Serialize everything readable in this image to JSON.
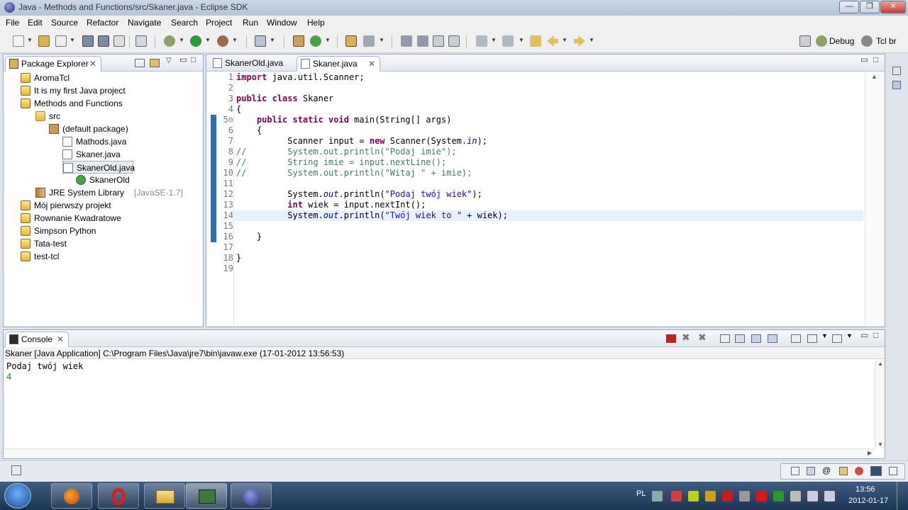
{
  "window": {
    "title": "Java - Methods and Functions/src/Skaner.java - Eclipse SDK",
    "minimize_label": "—",
    "restore_label": "❐",
    "close_label": "✕"
  },
  "menu": [
    "File",
    "Edit",
    "Source",
    "Refactor",
    "Navigate",
    "Search",
    "Project",
    "Run",
    "Window",
    "Help"
  ],
  "perspectives": {
    "debug_label": "Debug",
    "tcl_label": "Tcl br"
  },
  "package_explorer": {
    "title": "Package Explorer",
    "items": [
      {
        "label": "AromaTcl",
        "icon": "project-folder-icon",
        "extra": ""
      },
      {
        "label": "It is my first Java project",
        "icon": "project-folder-icon",
        "extra": ""
      },
      {
        "label": "Methods and Functions",
        "icon": "project-folder-icon",
        "extra": ""
      },
      {
        "label": "src",
        "icon": "source-folder-icon",
        "extra": ""
      },
      {
        "label": "(default package)",
        "icon": "package-icon",
        "extra": ""
      },
      {
        "label": "Mathods.java",
        "icon": "java-file-icon",
        "extra": ""
      },
      {
        "label": "Skaner.java",
        "icon": "java-file-icon",
        "extra": ""
      },
      {
        "label": "SkanerOld.java",
        "icon": "java-file-icon",
        "extra": ""
      },
      {
        "label": "SkanerOld",
        "icon": "class-icon",
        "extra": ""
      },
      {
        "label": "JRE System Library",
        "icon": "library-icon",
        "extra": "[JavaSE-1.7]"
      },
      {
        "label": "Mój pierwszy projekt",
        "icon": "project-folder-icon",
        "extra": ""
      },
      {
        "label": "Rownanie Kwadratowe",
        "icon": "project-folder-icon",
        "extra": ""
      },
      {
        "label": "Simpson Python",
        "icon": "project-folder-icon",
        "extra": ""
      },
      {
        "label": "Tata-test",
        "icon": "project-folder-icon",
        "extra": ""
      },
      {
        "label": "test-tcl",
        "icon": "project-folder-icon",
        "extra": ""
      }
    ]
  },
  "editor": {
    "tabs": [
      {
        "label": "SkanerOld.java"
      },
      {
        "label": "Skaner.java"
      }
    ],
    "lines": [
      {
        "n": "1",
        "segments": [
          {
            "t": "kw",
            "v": "import"
          },
          {
            "t": "plain",
            "v": " java.util.Scanner;"
          }
        ]
      },
      {
        "n": "2",
        "segments": []
      },
      {
        "n": "3",
        "segments": [
          {
            "t": "kw",
            "v": "public class"
          },
          {
            "t": "plain",
            "v": " Skaner"
          }
        ]
      },
      {
        "n": "4",
        "segments": [
          {
            "t": "plain",
            "v": "{"
          }
        ]
      },
      {
        "n": "5⊖",
        "segments": [
          {
            "t": "plain",
            "v": "    "
          },
          {
            "t": "kw",
            "v": "public static void"
          },
          {
            "t": "plain",
            "v": " main(String[] args)"
          }
        ]
      },
      {
        "n": "6",
        "segments": [
          {
            "t": "plain",
            "v": "    {"
          }
        ]
      },
      {
        "n": "7",
        "segments": [
          {
            "t": "plain",
            "v": "          Scanner input = "
          },
          {
            "t": "kw",
            "v": "new"
          },
          {
            "t": "plain",
            "v": " Scanner(System."
          },
          {
            "t": "fld",
            "v": "in"
          },
          {
            "t": "plain",
            "v": ");"
          }
        ]
      },
      {
        "n": "8",
        "segments": [
          {
            "t": "cmt",
            "v": "//        System.out.println(\"Podaj imie\");"
          }
        ]
      },
      {
        "n": "9",
        "segments": [
          {
            "t": "cmt",
            "v": "//        String imie = input.nextLine();"
          }
        ]
      },
      {
        "n": "10",
        "segments": [
          {
            "t": "cmt",
            "v": "//        System.out.println(\"Witaj \" + imie);"
          }
        ]
      },
      {
        "n": "11",
        "segments": []
      },
      {
        "n": "12",
        "segments": [
          {
            "t": "plain",
            "v": "          System."
          },
          {
            "t": "fld",
            "v": "out"
          },
          {
            "t": "plain",
            "v": ".println("
          },
          {
            "t": "str",
            "v": "\"Podaj twój wiek\""
          },
          {
            "t": "plain",
            "v": ");"
          }
        ]
      },
      {
        "n": "13",
        "segments": [
          {
            "t": "plain",
            "v": "          "
          },
          {
            "t": "kw",
            "v": "int"
          },
          {
            "t": "plain",
            "v": " wiek = input.nextInt();"
          }
        ]
      },
      {
        "n": "14",
        "segments": [
          {
            "t": "plain",
            "v": "          System."
          },
          {
            "t": "fld",
            "v": "out"
          },
          {
            "t": "plain",
            "v": ".println("
          },
          {
            "t": "str",
            "v": "\"Twój wiek to \""
          },
          {
            "t": "plain",
            "v": " + wiek);"
          }
        ]
      },
      {
        "n": "15",
        "segments": []
      },
      {
        "n": "16",
        "segments": [
          {
            "t": "plain",
            "v": "    }"
          }
        ]
      },
      {
        "n": "17",
        "segments": []
      },
      {
        "n": "18",
        "segments": [
          {
            "t": "plain",
            "v": "}"
          }
        ]
      },
      {
        "n": "19",
        "segments": []
      }
    ]
  },
  "console": {
    "title": "Console",
    "process_line": "Skaner [Java Application] C:\\Program Files\\Java\\jre7\\bin\\javaw.exe (17-01-2012 13:56:53)",
    "output": [
      "Podaj twój wiek"
    ],
    "input": [
      "4"
    ]
  },
  "taskbar": {
    "language": "PL",
    "time": "13:56",
    "date": "2012-01-17"
  },
  "colors": {
    "keyword": "#7f0055",
    "string": "#2a00ff",
    "comment": "#3f7f5f",
    "field": "#0000c0",
    "console_input": "#00a000",
    "taskbar": "#2a4567"
  }
}
